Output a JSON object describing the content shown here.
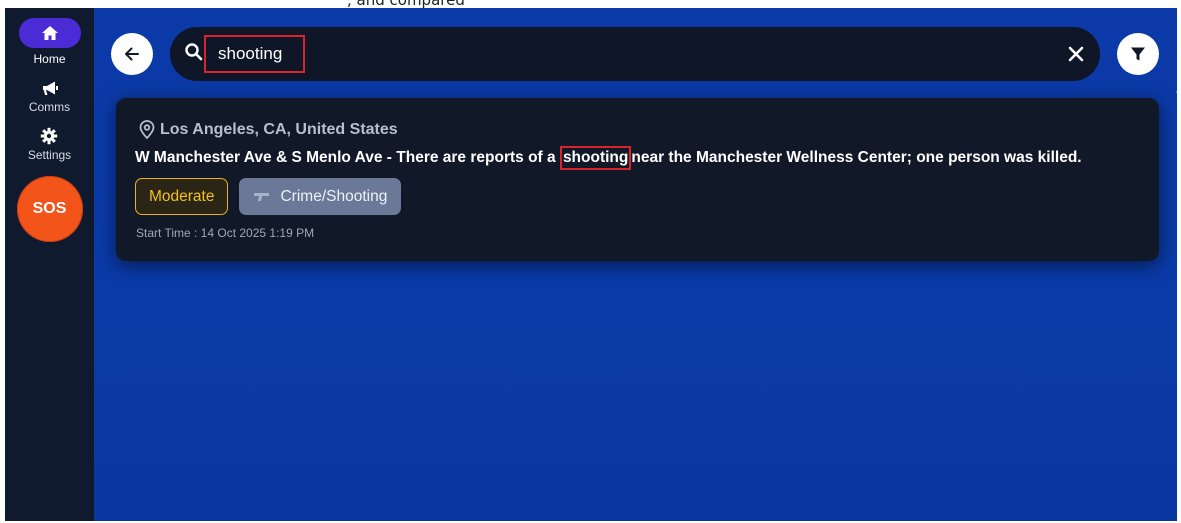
{
  "header_caption": ", and compared",
  "sidebar": {
    "items": [
      {
        "label": "Home",
        "icon": "home-icon"
      },
      {
        "label": "Comms",
        "icon": "megaphone-icon"
      },
      {
        "label": "Settings",
        "icon": "gear-icon"
      }
    ],
    "sos_label": "SOS"
  },
  "search": {
    "value": "shooting",
    "back_icon": "arrow-left-icon",
    "clear_icon": "close-icon",
    "filter_icon": "filter-icon"
  },
  "result": {
    "location": "Los Angeles, CA, United States",
    "description_before": "W Manchester Ave & S Menlo Ave - There are reports of a",
    "highlight": "shooting",
    "description_after": "near the Manchester Wellness Center; one person was killed.",
    "severity": "Moderate",
    "category": "Crime/Shooting",
    "start_time": "Start Time : 14 Oct 2025 1:19 PM"
  },
  "colors": {
    "background": "#0a3aa7",
    "sidebar": "#0f1a2f",
    "card": "#111827",
    "accent_active": "#4b2bd6",
    "sos": "#f2541a",
    "highlight_border": "#d9242d",
    "moderate": "#f3c21f",
    "category_tag": "#6b7898"
  }
}
